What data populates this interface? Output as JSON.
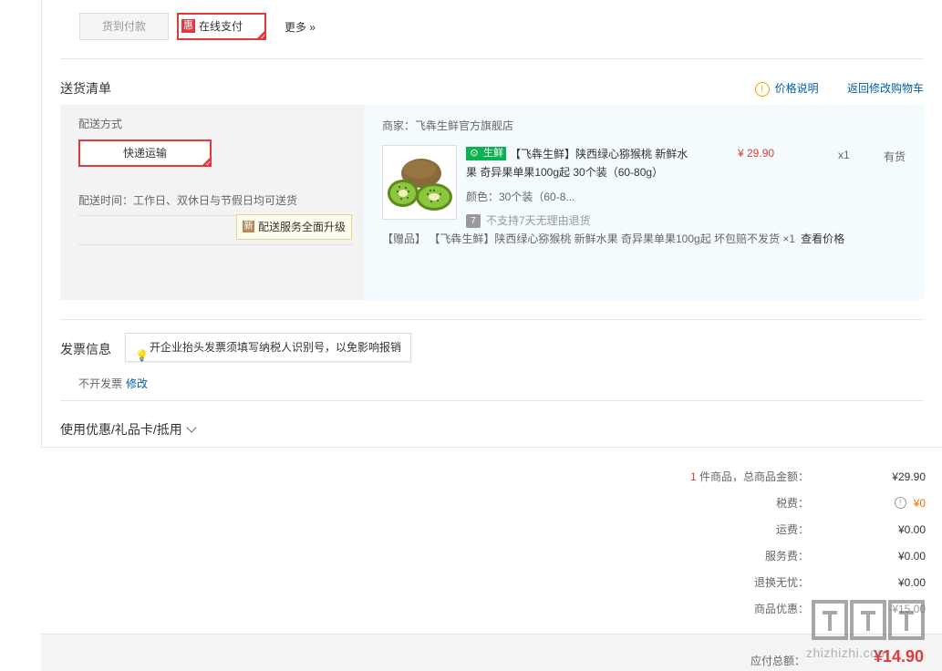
{
  "payment": {
    "cod_label": "货到付款",
    "online_badge": "惠",
    "online_label": "在线支付",
    "more_label": "更多 »"
  },
  "delivery": {
    "section_title": "送货清单",
    "price_note_label": "价格说明",
    "back_to_cart_label": "返回修改购物车",
    "method_label": "配送方式",
    "method_value": "快递运输",
    "time_text": "配送时间：工作日、双休日与节假日均可送货",
    "upgrade_badge": "新",
    "upgrade_text": "配送服务全面升级"
  },
  "order_item": {
    "merchant": "商家：飞犇生鲜官方旗舰店",
    "fresh_tag": "生鲜",
    "title": "【飞犇生鲜】陕西绿心猕猴桃 新鲜水果 奇异果单果100g起 30个装（60-80g）",
    "color": "颜色：30个装（60-8...",
    "no_return": "不支持7天无理由退货",
    "no_return_icon": "7",
    "price": "¥ 29.90",
    "quantity": "x1",
    "stock": "有货",
    "gift_text": "【赠品】 【飞犇生鲜】陕西绿心猕猴桃 新鲜水果 奇异果单果100g起 坏包赔不发货 ×1",
    "gift_link": "查看价格"
  },
  "invoice": {
    "section_title": "发票信息",
    "tip": "开企业抬头发票须填写纳税人识别号，以免影响报销",
    "value": "不开发票",
    "modify_label": "修改"
  },
  "discount": {
    "toggle_label": "使用优惠/礼品卡/抵用"
  },
  "summary": {
    "item_count": "1",
    "item_label": " 件商品，总商品金额：",
    "item_amount": "¥29.90",
    "tax_label": "税费：",
    "tax_value": "¥0",
    "shipping_label": "运费：",
    "shipping_value": "¥0.00",
    "service_label": "服务费：",
    "service_value": "¥0.00",
    "return_label": "退换无忧：",
    "return_value": "¥0.00",
    "promo_label": "商品优惠：",
    "promo_value": "-¥15.00",
    "total_label": "应付总额：",
    "total_value": "¥14.90"
  },
  "watermark": {
    "text": "zhizhizhi.com"
  },
  "colors": {
    "accent_red": "#e4393c",
    "link_blue": "#005ea7",
    "fresh_green": "#0bb150",
    "tax_orange": "#ff6a00"
  },
  "icons": [
    "hui-badge",
    "corner-check-icon",
    "info-icon",
    "new-badge",
    "fresh-icon",
    "seven-day-icon",
    "bulb-icon",
    "chevron-down-icon",
    "question-icon"
  ]
}
